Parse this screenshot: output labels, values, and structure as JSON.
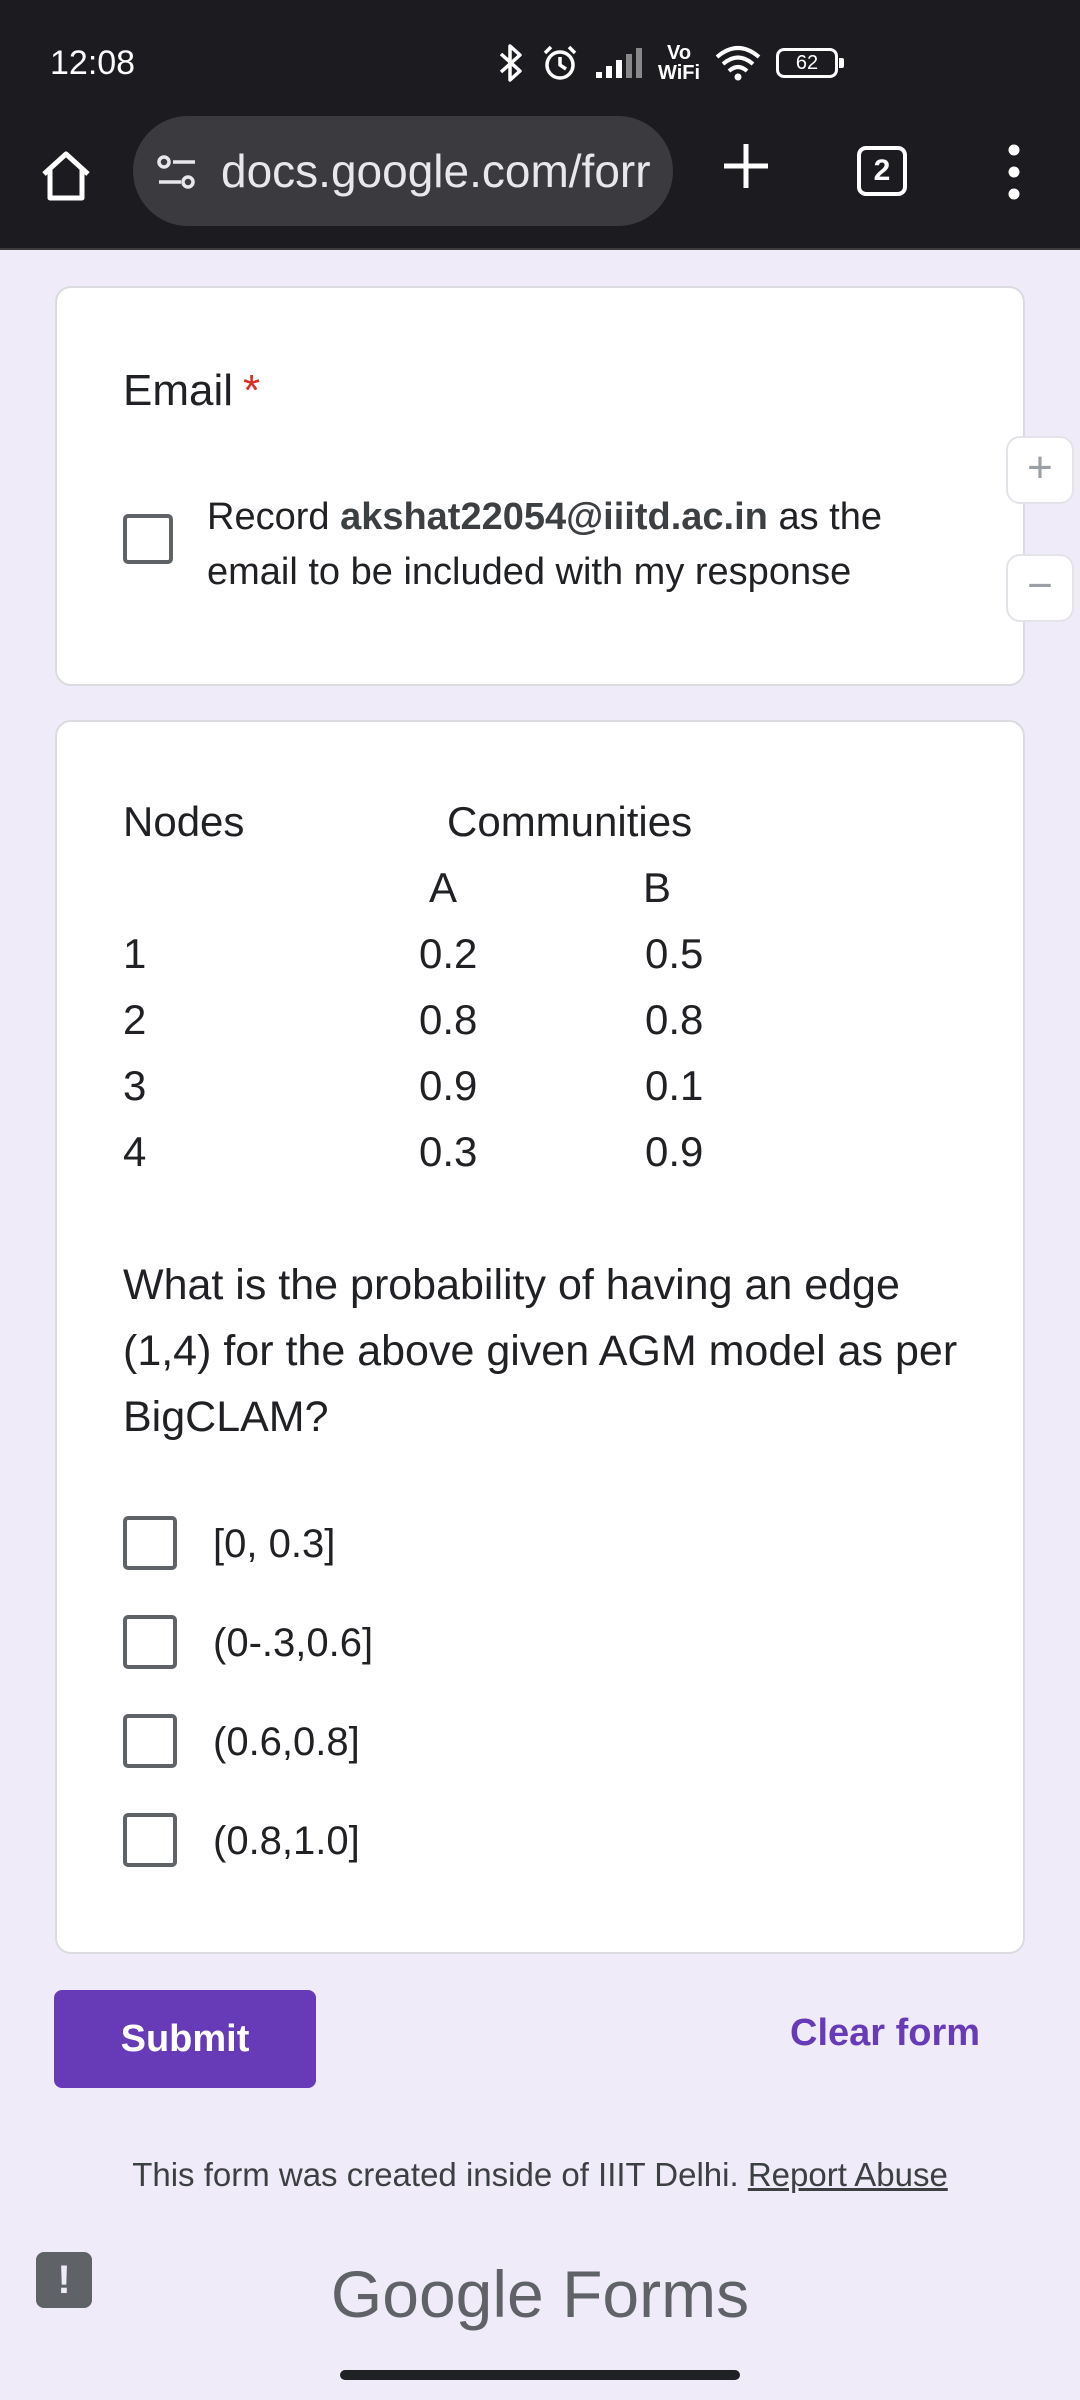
{
  "status_bar": {
    "time": "12:08",
    "vowifi_line1": "Vo",
    "vowifi_line2": "WiFi",
    "battery": "62",
    "icons": [
      "bluetooth-icon",
      "alarm-icon",
      "signal-icon",
      "vowifi-icon",
      "wifi-icon",
      "battery-icon"
    ]
  },
  "browser": {
    "url": "docs.google.com/forr",
    "tab_count": "2",
    "icons": [
      "home-icon",
      "site-settings-icon",
      "plus-icon",
      "tabs-icon",
      "more-vert-icon"
    ]
  },
  "email_card": {
    "title": "Email",
    "required_mark": "*",
    "record_prefix": "Record ",
    "email": "akshat22054@iiitd.ac.in",
    "record_suffix": " as the email to be included with my response"
  },
  "side_controls": {
    "zoom_in": "+",
    "zoom_out": "−"
  },
  "question_card": {
    "table": {
      "header_nodes": "Nodes",
      "header_communities": "Communities",
      "col_a": "A",
      "col_b": "B",
      "rows": [
        {
          "node": "1",
          "a": "0.2",
          "b": "0.5"
        },
        {
          "node": "2",
          "a": "0.8",
          "b": "0.8"
        },
        {
          "node": "3",
          "a": "0.9",
          "b": "0.1"
        },
        {
          "node": "4",
          "a": "0.3",
          "b": "0.9"
        }
      ]
    },
    "question": "What is the probability of having an edge (1,4) for the above given AGM model as per BigCLAM?",
    "options": [
      "[0, 0.3]",
      "(0-.3,0.6]",
      "(0.6,0.8]",
      "(0.8,1.0]"
    ]
  },
  "actions": {
    "submit": "Submit",
    "clear": "Clear form"
  },
  "footer": {
    "note": "This form was created inside of IIIT Delhi.",
    "report": "Report Abuse",
    "logo_google": "Google",
    "logo_forms": "Forms",
    "feedback": "!"
  },
  "colors": {
    "accent": "#673ab7",
    "background": "#f0ebf8",
    "required": "#d93025"
  }
}
